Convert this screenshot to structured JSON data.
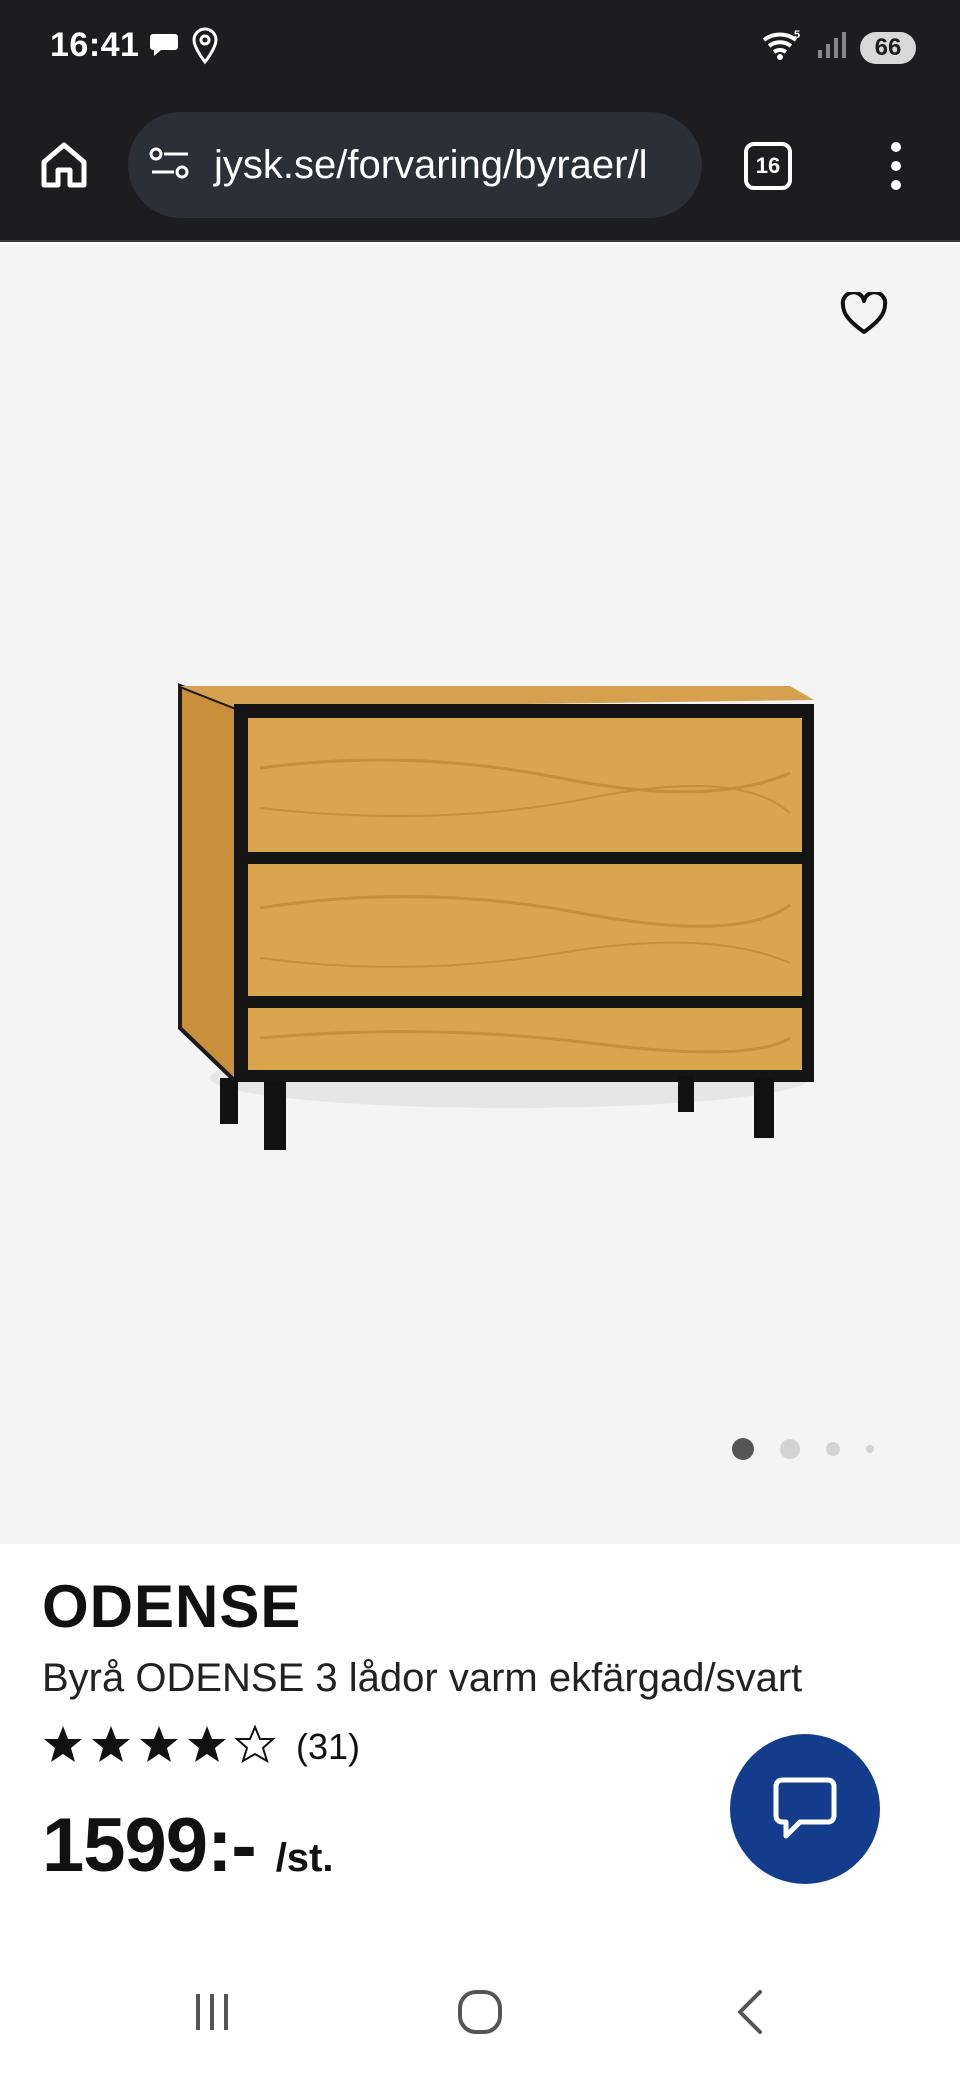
{
  "status_bar": {
    "time": "16:41",
    "battery": "66",
    "icons": [
      "chat-bubble-icon",
      "location-pin-icon",
      "wifi-icon",
      "signal-icon"
    ]
  },
  "browser": {
    "url": "jysk.se/forvaring/byraer/l",
    "tab_count": "16",
    "icons": [
      "home-icon",
      "site-settings-icon",
      "tabs-icon",
      "more-vert-icon"
    ]
  },
  "gallery": {
    "image_count": 4,
    "active_index": 0,
    "icons": [
      "heart-icon"
    ]
  },
  "product": {
    "brand": "ODENSE",
    "description": "Byrå ODENSE 3 lådor varm ekfärgad/svart",
    "rating": 4,
    "rating_max": 5,
    "review_count": "(31)",
    "price": "1599:-",
    "unit": "/st."
  },
  "chat": {
    "icon": "chat-icon",
    "color": "#143c8c"
  },
  "nav": {
    "icons": [
      "recent-apps-icon",
      "home-circle-icon",
      "back-icon"
    ]
  }
}
